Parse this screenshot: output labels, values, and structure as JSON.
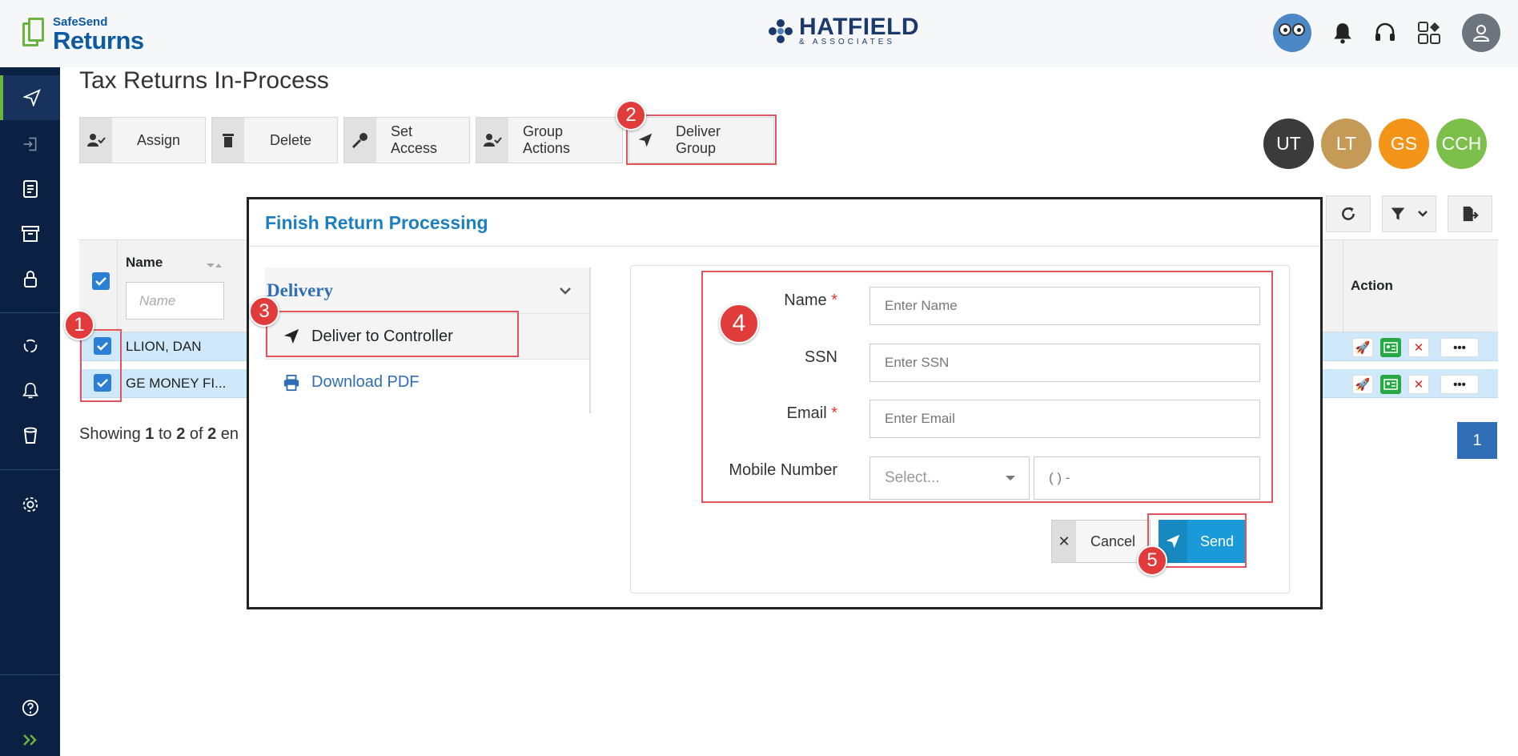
{
  "header": {
    "logo_line1": "SafeSend",
    "logo_line2": "Returns",
    "brand_name": "HATFIELD",
    "brand_sub": "& ASSOCIATES"
  },
  "page": {
    "title": "Tax Returns In-Process"
  },
  "toolbar": {
    "assign": "Assign",
    "delete": "Delete",
    "set_access": "Set Access",
    "group_actions": "Group Actions",
    "deliver_group": "Deliver Group"
  },
  "user_circles": [
    {
      "label": "UT",
      "color": "#3b3b3b"
    },
    {
      "label": "LT",
      "color": "#c49a56"
    },
    {
      "label": "GS",
      "color": "#f39318"
    },
    {
      "label": "CCH",
      "color": "#7cc04b"
    }
  ],
  "table": {
    "name_header": "Name",
    "name_filter_placeholder": "Name",
    "action_header": "Action",
    "rows": [
      {
        "name": "LLION, DAN"
      },
      {
        "name": "GE MONEY FI..."
      }
    ]
  },
  "footer": {
    "showing_prefix": "Showing ",
    "from": "1",
    "to_word": " to ",
    "to": "2",
    "of_word": " of ",
    "total": "2",
    "suffix": " en",
    "current_page": "1"
  },
  "modal": {
    "title": "Finish Return Processing",
    "section": "Delivery",
    "nav_items": [
      {
        "label": "Deliver to Controller"
      },
      {
        "label": "Download PDF"
      }
    ],
    "form": {
      "name_label": "Name",
      "name_placeholder": "Enter Name",
      "ssn_label": "SSN",
      "ssn_placeholder": "Enter SSN",
      "email_label": "Email",
      "email_placeholder": "Enter Email",
      "mobile_label": "Mobile Number",
      "country_placeholder": "Select...",
      "phone_placeholder": "( ) -",
      "required_mark": "*"
    },
    "cancel": "Cancel",
    "send": "Send"
  },
  "callouts": [
    "1",
    "2",
    "3",
    "4",
    "5"
  ],
  "colors": {
    "sidebar": "#0b2144",
    "accent_green": "#6cb33f",
    "modal_title": "#1b7fc2",
    "send_button": "#1a9ad9",
    "callout": "#e23b3b"
  }
}
